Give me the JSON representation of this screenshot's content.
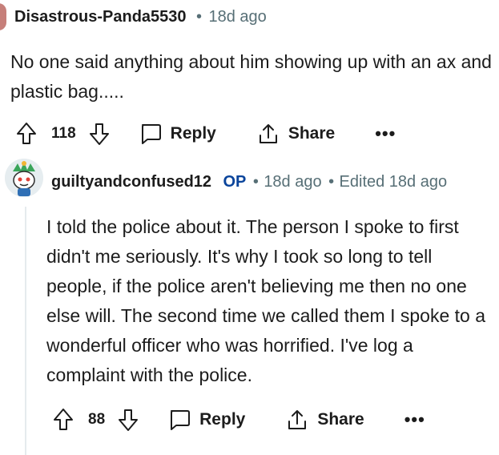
{
  "comment1": {
    "author": "Disastrous-Panda5530",
    "separator": "•",
    "time": "18d ago",
    "body": "No one said anything about him showing up with an ax and plastic bag.....",
    "votes": "118",
    "reply_label": "Reply",
    "share_label": "Share",
    "more_label": "•••"
  },
  "comment2": {
    "author": "guiltyandconfused12",
    "op_badge": "OP",
    "separator": "•",
    "time": "18d ago",
    "edited": "Edited 18d ago",
    "body": "I told the police about it. The person I spoke to first didn't me seriously. It's why I took so long to tell people, if the police aren't believing me then no one else will. The second time we called them I spoke to a wonderful officer who was horrified. I've log a complaint with the police.",
    "votes": "88",
    "reply_label": "Reply",
    "share_label": "Share",
    "more_label": "•••"
  },
  "colors": {
    "meta": "#576f76",
    "op": "#0a449b",
    "avatar1": "#c67f7a",
    "thread_line": "#e5ebee"
  },
  "icons": [
    "upvote-icon",
    "downvote-icon",
    "reply-icon",
    "share-icon",
    "more-icon"
  ]
}
